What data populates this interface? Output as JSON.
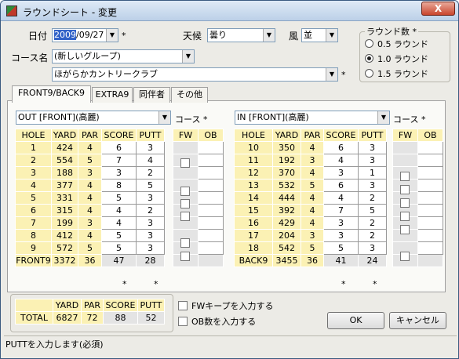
{
  "window": {
    "title": "ラウンドシート - 変更",
    "close": "X"
  },
  "form": {
    "date_label": "日付",
    "date_year": "2009",
    "date_rest": "/09/27",
    "date_star": "*",
    "weather_label": "天候",
    "weather_value": "曇り",
    "wind_label": "風",
    "wind_value": "並",
    "course_name_label": "コース名",
    "course_group": "(新しいグループ)",
    "course_name": "ほがらかカントリークラブ",
    "course_star": "*",
    "rounds_label": "ラウンド数 *",
    "rounds_options": [
      "0.5 ラウンド",
      "1.0 ラウンド",
      "1.5 ラウンド"
    ]
  },
  "tabs": [
    "FRONT9/BACK9",
    "EXTRA9",
    "同伴者",
    "その他"
  ],
  "out": {
    "course_select": "OUT [FRONT](高麗)",
    "course_label": "コース *",
    "headers": [
      "HOLE",
      "YARD",
      "PAR",
      "SCORE",
      "PUTT"
    ],
    "fw_headers": [
      "FW",
      "OB"
    ],
    "rows": [
      [
        "1",
        "424",
        "4",
        "6",
        "3"
      ],
      [
        "2",
        "554",
        "5",
        "7",
        "4"
      ],
      [
        "3",
        "188",
        "3",
        "3",
        "2"
      ],
      [
        "4",
        "377",
        "4",
        "8",
        "5"
      ],
      [
        "5",
        "331",
        "4",
        "5",
        "3"
      ],
      [
        "6",
        "315",
        "4",
        "4",
        "2"
      ],
      [
        "7",
        "199",
        "3",
        "4",
        "3"
      ],
      [
        "8",
        "412",
        "4",
        "5",
        "3"
      ],
      [
        "9",
        "572",
        "5",
        "5",
        "3"
      ]
    ],
    "total": [
      "FRONT9",
      "3372",
      "36",
      "47",
      "28"
    ]
  },
  "in": {
    "course_select": "IN [FRONT](高麗)",
    "course_label": "コース *",
    "headers": [
      "HOLE",
      "YARD",
      "PAR",
      "SCORE",
      "PUTT"
    ],
    "fw_headers": [
      "FW",
      "OB"
    ],
    "rows": [
      [
        "10",
        "350",
        "4",
        "6",
        "3"
      ],
      [
        "11",
        "192",
        "3",
        "4",
        "3"
      ],
      [
        "12",
        "370",
        "4",
        "3",
        "1"
      ],
      [
        "13",
        "532",
        "5",
        "6",
        "3"
      ],
      [
        "14",
        "444",
        "4",
        "4",
        "2"
      ],
      [
        "15",
        "392",
        "4",
        "7",
        "5"
      ],
      [
        "16",
        "429",
        "4",
        "3",
        "2"
      ],
      [
        "17",
        "204",
        "3",
        "3",
        "2"
      ],
      [
        "18",
        "542",
        "5",
        "5",
        "3"
      ]
    ],
    "total": [
      "BACK9",
      "3455",
      "36",
      "41",
      "24"
    ]
  },
  "summary": {
    "headers": [
      "",
      "YARD",
      "PAR",
      "SCORE",
      "PUTT"
    ],
    "row": [
      "TOTAL",
      "6827",
      "72",
      "88",
      "52"
    ]
  },
  "options": {
    "fw_keep": "FWキープを入力する",
    "ob_count": "OB数を入力する"
  },
  "buttons": {
    "ok": "OK",
    "cancel": "キャンセル"
  },
  "status": "PUTTを入力します(必須)",
  "star": "*"
}
